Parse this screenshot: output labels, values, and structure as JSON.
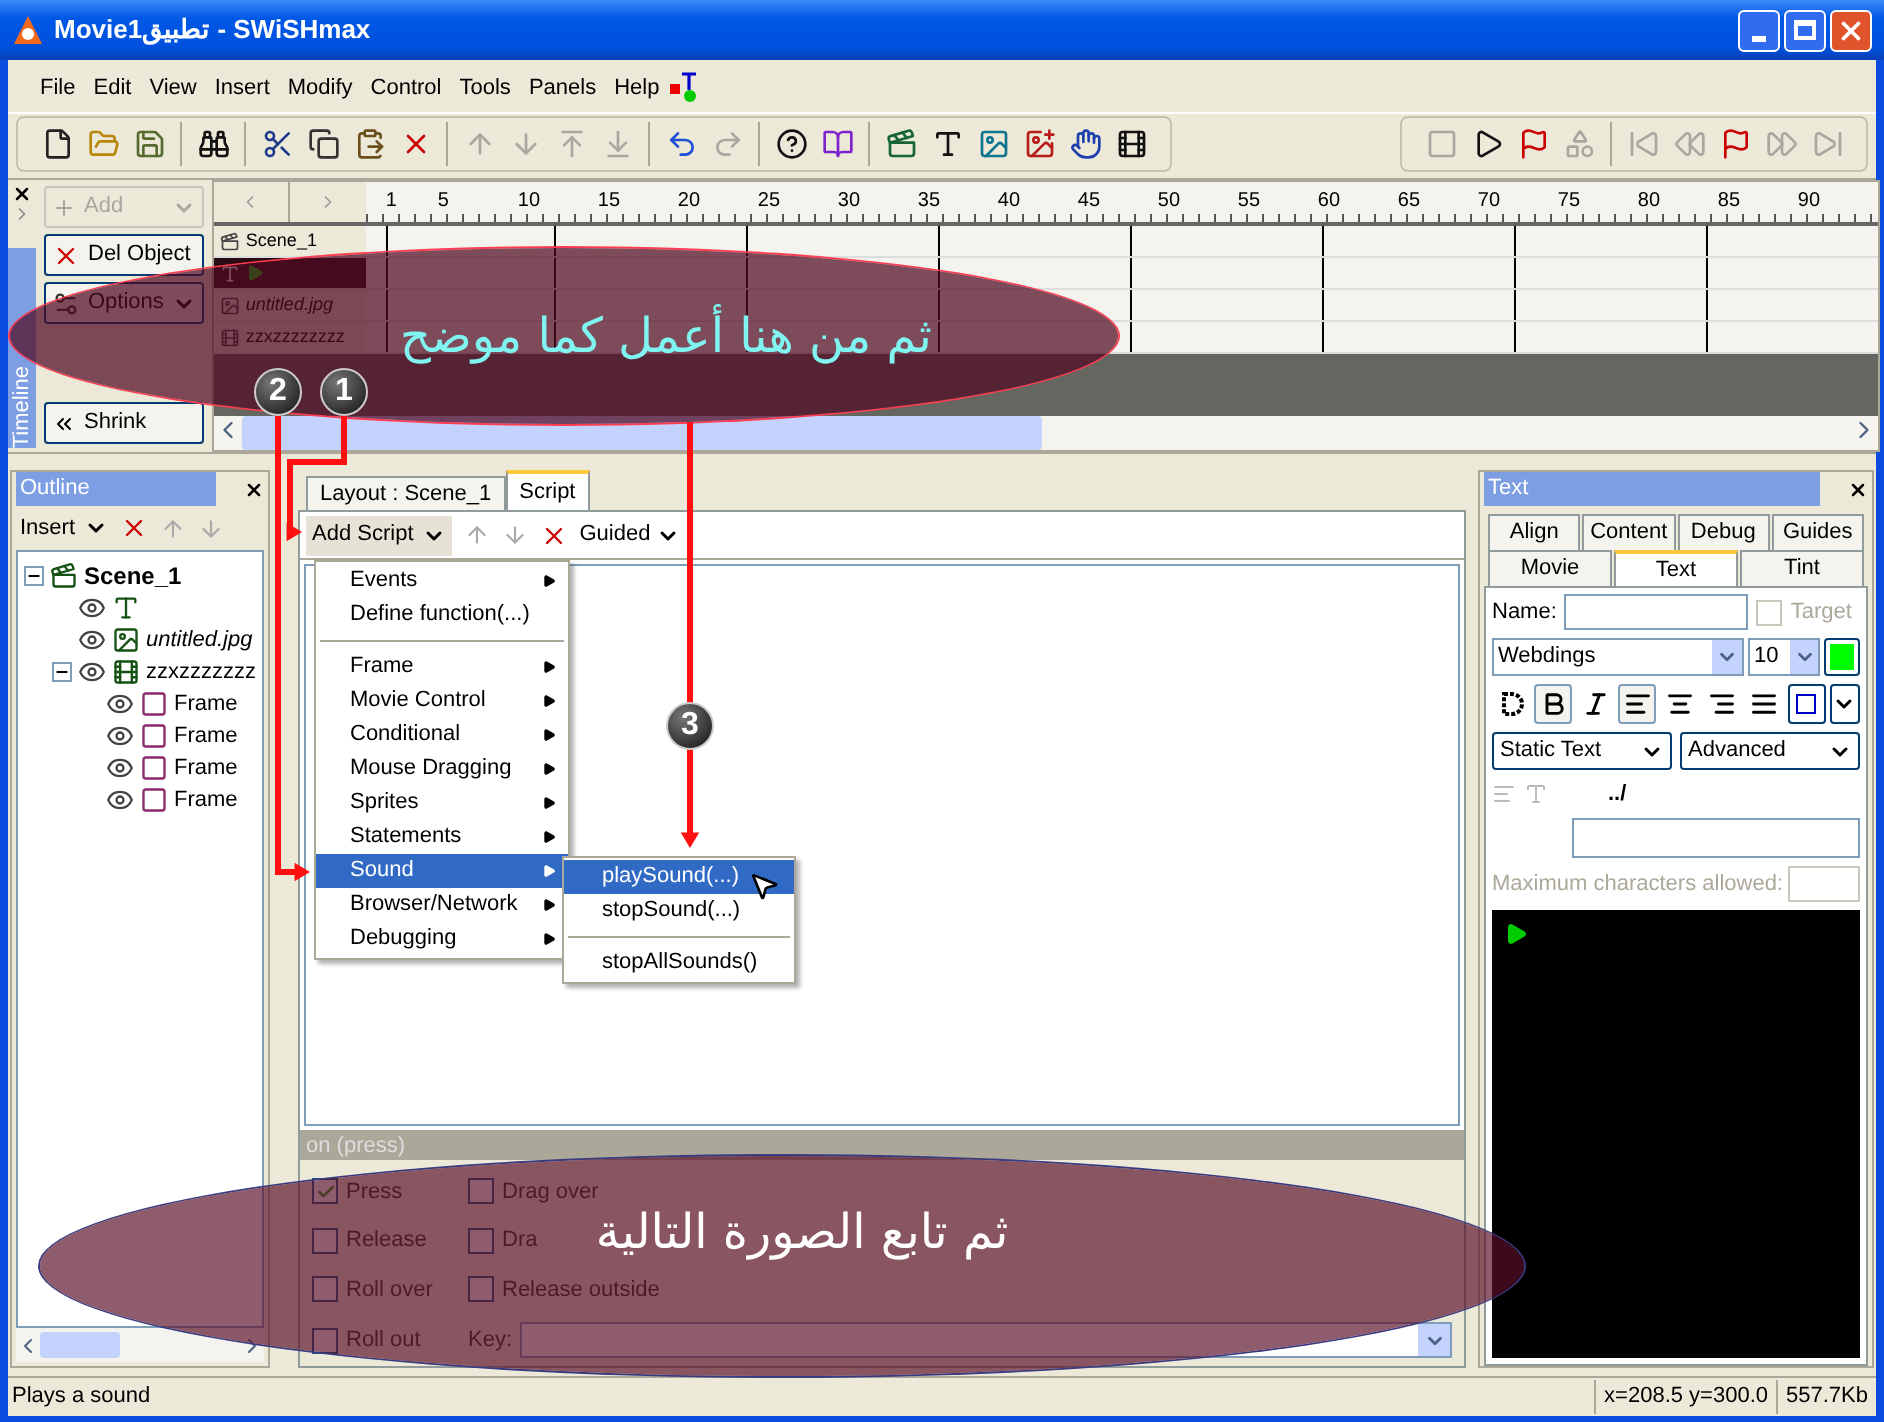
{
  "window": {
    "title": "Movieتطبيق1 - SWiSHmax"
  },
  "menu": [
    "File",
    "Edit",
    "View",
    "Insert",
    "Modify",
    "Control",
    "Tools",
    "Panels",
    "Help"
  ],
  "toolbar": {
    "groups": [
      [
        {
          "kind": "new",
          "disabled": false
        },
        {
          "kind": "open",
          "disabled": false
        },
        {
          "kind": "save",
          "disabled": false
        }
      ],
      [
        {
          "kind": "find",
          "disabled": false
        }
      ],
      [
        {
          "kind": "cut",
          "disabled": false
        },
        {
          "kind": "copy",
          "disabled": false
        },
        {
          "kind": "paste",
          "disabled": false
        },
        {
          "kind": "delete",
          "disabled": false
        }
      ],
      [
        {
          "kind": "up",
          "disabled": true
        },
        {
          "kind": "down",
          "disabled": true
        },
        {
          "kind": "top",
          "disabled": true
        },
        {
          "kind": "bottom",
          "disabled": true
        }
      ],
      [
        {
          "kind": "undo",
          "disabled": false
        },
        {
          "kind": "redo",
          "disabled": true
        }
      ],
      [
        {
          "kind": "help",
          "disabled": false
        },
        {
          "kind": "book",
          "disabled": false
        }
      ],
      [
        {
          "kind": "scene",
          "disabled": false
        },
        {
          "kind": "text",
          "disabled": false
        },
        {
          "kind": "image",
          "disabled": false
        },
        {
          "kind": "content",
          "disabled": false
        },
        {
          "kind": "button",
          "disabled": false
        },
        {
          "kind": "sprite",
          "disabled": false
        }
      ]
    ]
  },
  "playback": {
    "groups": [
      [
        {
          "kind": "stop",
          "disabled": true
        },
        {
          "kind": "play",
          "disabled": false
        },
        {
          "kind": "frame",
          "disabled": false
        },
        {
          "kind": "effect",
          "disabled": true
        }
      ],
      [
        {
          "kind": "first",
          "disabled": true
        },
        {
          "kind": "prev",
          "disabled": true
        },
        {
          "kind": "playto",
          "disabled": false
        },
        {
          "kind": "next",
          "disabled": true
        },
        {
          "kind": "last",
          "disabled": true
        }
      ]
    ]
  },
  "timeline": {
    "label": "Timeline",
    "buttons": [
      {
        "label": "Add",
        "kind": "add",
        "disabled": true
      },
      {
        "label": "Del Object",
        "kind": "delete",
        "disabled": false
      },
      {
        "label": "Options",
        "kind": "options",
        "disabled": false
      }
    ],
    "shrink": "Shrink",
    "ruler": [
      "1",
      "5",
      "10",
      "15",
      "20",
      "25",
      "30",
      "35",
      "40",
      "45",
      "50",
      "55",
      "60",
      "65",
      "70",
      "75",
      "80",
      "85",
      "90"
    ],
    "layers": [
      {
        "kind": "scene",
        "name": "Scene_1",
        "selected": false
      },
      {
        "kind": "text",
        "selected": true
      },
      {
        "kind": "image",
        "name": "untitled.jpg",
        "selected": false
      },
      {
        "kind": "sprite",
        "name": "zzxzzzzzzzz",
        "selected": false
      }
    ]
  },
  "outline": {
    "title": "Outline",
    "insert": "Insert",
    "tree": [
      {
        "kind": "scene",
        "label": "Scene_1",
        "expanded": true,
        "children": [
          {
            "kind": "text"
          },
          {
            "kind": "image",
            "label": "untitled.jpg"
          },
          {
            "kind": "sprite",
            "label": "zzxzzzzzzz",
            "expanded": true,
            "children": [
              {
                "kind": "frame",
                "label": "Frame"
              },
              {
                "kind": "frame",
                "label": "Frame"
              },
              {
                "kind": "frame",
                "label": "Frame"
              },
              {
                "kind": "frame",
                "label": "Frame"
              }
            ]
          }
        ]
      }
    ]
  },
  "script": {
    "tabs": [
      {
        "label": "Layout : Scene_1",
        "selected": false
      },
      {
        "label": "Script",
        "selected": true
      }
    ],
    "add_script": "Add Script",
    "guided": "Guided",
    "menu": [
      {
        "kind": "item",
        "label": "Events",
        "submenu": true,
        "selected": false
      },
      {
        "kind": "item",
        "label": "Define function(...)",
        "submenu": false,
        "selected": false
      },
      {
        "kind": "separator"
      },
      {
        "kind": "item",
        "label": "Frame",
        "submenu": true,
        "selected": false
      },
      {
        "kind": "item",
        "label": "Movie Control",
        "submenu": true,
        "selected": false
      },
      {
        "kind": "item",
        "label": "Conditional",
        "submenu": true,
        "selected": false
      },
      {
        "kind": "item",
        "label": "Mouse Dragging",
        "submenu": true,
        "selected": false
      },
      {
        "kind": "item",
        "label": "Sprites",
        "submenu": true,
        "selected": false
      },
      {
        "kind": "item",
        "label": "Statements",
        "submenu": true,
        "selected": false
      },
      {
        "kind": "item",
        "label": "Sound",
        "submenu": true,
        "selected": true
      },
      {
        "kind": "item",
        "label": "Browser/Network",
        "submenu": true,
        "selected": false
      },
      {
        "kind": "item",
        "label": "Debugging",
        "submenu": true,
        "selected": false
      }
    ],
    "submenu": [
      {
        "kind": "item",
        "label": "playSound(...)",
        "selected": true
      },
      {
        "kind": "item",
        "label": "stopSound(...)",
        "selected": false
      },
      {
        "kind": "separator"
      },
      {
        "kind": "item",
        "label": "stopAllSounds()",
        "selected": false
      }
    ],
    "event_header": "on (press)",
    "events": [
      {
        "label": "Press",
        "checked": true
      },
      {
        "label": "Drag over",
        "checked": false
      },
      {
        "label": "Release",
        "checked": false
      },
      {
        "label": "Dra",
        "checked": false
      },
      {
        "label": "Roll over",
        "checked": false
      },
      {
        "label": "Release outside",
        "checked": false
      },
      {
        "label": "Roll out",
        "checked": false
      }
    ],
    "key_label": "Key:"
  },
  "text_panel": {
    "title": "Text",
    "tab_rows": [
      [
        {
          "label": "Align",
          "selected": false
        },
        {
          "label": "Content",
          "selected": false
        },
        {
          "label": "Debug",
          "selected": false
        },
        {
          "label": "Guides",
          "selected": false
        }
      ],
      [
        {
          "label": "Movie",
          "selected": false
        },
        {
          "label": "Text",
          "selected": true
        },
        {
          "label": "Tint",
          "selected": false
        }
      ]
    ],
    "name_label": "Name:",
    "target": {
      "label": "Target",
      "checked": false,
      "disabled": true
    },
    "font": "Webdings",
    "size": "10",
    "color": "#00ff00",
    "format_buttons": [
      {
        "kind": "outline",
        "pressed": false
      },
      {
        "kind": "bold",
        "pressed": true
      },
      {
        "kind": "italic",
        "pressed": false
      },
      {
        "kind": "left",
        "pressed": true
      },
      {
        "kind": "center",
        "pressed": false
      },
      {
        "kind": "right",
        "pressed": false
      },
      {
        "kind": "justify",
        "pressed": false
      }
    ],
    "text_type": "Static Text",
    "advanced": "Advanced",
    "path": "../",
    "max_chars": {
      "label": "Maximum characters allowed:",
      "disabled": true
    }
  },
  "status_bar": {
    "message": "Plays a sound",
    "coords": "x=208.5 y=300.0",
    "size": "557.7Kb"
  },
  "annotations": {
    "callouts": [
      "ثم من هنا أعمل كما موضح",
      "ثم تابع الصورة التالية"
    ],
    "steps": [
      "1",
      "2",
      "3"
    ]
  }
}
